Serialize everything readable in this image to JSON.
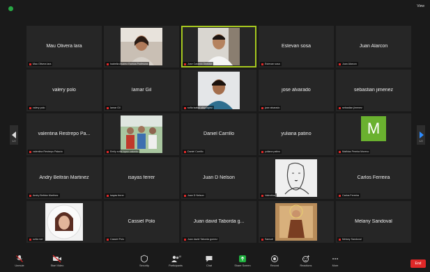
{
  "topbar": {
    "view_label": "View"
  },
  "participants": [
    {
      "name": "Mau Olivera lara",
      "label": "Mau Olivera lara",
      "video": false
    },
    {
      "name": "",
      "label": "Isabella Alvarez Ramos Profesora",
      "video": true,
      "avatar": "woman-portrait"
    },
    {
      "name": "",
      "label": "Jose Caicedo Director",
      "video": true,
      "avatar": "man-portrait",
      "active": true
    },
    {
      "name": "Estevan sosa",
      "label": "Estevan sosa",
      "video": false
    },
    {
      "name": "Juan Alarcon",
      "label": "Juan Alarcon",
      "video": false
    },
    {
      "name": "valery polo",
      "label": "valery polo",
      "video": false
    },
    {
      "name": "Iamar Gil",
      "label": "Iamar Gil",
      "video": false
    },
    {
      "name": "",
      "label": "sofia isabel silva lopez",
      "video": true,
      "avatar": "teen-portrait"
    },
    {
      "name": "jose alvarado",
      "label": "jose alvarado",
      "video": false
    },
    {
      "name": "sebastian jimenez",
      "label": "sebastian jimenez",
      "video": false
    },
    {
      "name": "valentina Restrepo Pa...",
      "label": "valentina Restrepo Palacio",
      "video": false
    },
    {
      "name": "",
      "label": "Emily sofia lopez caicedo",
      "video": true,
      "avatar": "group-photo"
    },
    {
      "name": "Daniel Carrillo",
      "label": "Daniel Carrillo",
      "video": false
    },
    {
      "name": "yuliana patino",
      "label": "yuliana patino",
      "video": false
    },
    {
      "name": "",
      "label": "Mathias Pereira Moreno",
      "video": true,
      "avatar": "letter-m",
      "letter": "M"
    },
    {
      "name": "Andry Beltrán Martinez",
      "label": "Andry Beltrán Martinez",
      "video": false
    },
    {
      "name": "isayas ferrer",
      "label": "isayas ferrer",
      "video": false
    },
    {
      "name": "Juan D Nelson",
      "label": "Juan D Nelson",
      "video": false
    },
    {
      "name": "",
      "label": "Valentina",
      "video": true,
      "avatar": "sketch-portrait"
    },
    {
      "name": "Carlos Ferreira",
      "label": "Carlos Ferreira",
      "video": false
    },
    {
      "name": "",
      "label": "sofia mel",
      "video": true,
      "avatar": "girl-profile"
    },
    {
      "name": "Cassiel Polo",
      "label": "Cassiel Polo",
      "video": false
    },
    {
      "name": "Juan david Taborda g...",
      "label": "Juan david Taborda gomez",
      "video": false
    },
    {
      "name": "",
      "label": "Samuel",
      "video": true,
      "avatar": "saint-figure"
    },
    {
      "name": "Melany Sandoval",
      "label": "Melany Sandoval",
      "video": false
    }
  ],
  "pager": {
    "left": "1/2",
    "right": "1/2"
  },
  "toolbar": {
    "unmute": "Unmute",
    "start_video": "Start Video",
    "security": "Security",
    "participants": "Participants",
    "participants_count": "49",
    "chat": "Chat",
    "share_screen": "Share Screen",
    "record": "Record",
    "reactions": "Reactions",
    "more": "More",
    "end": "End"
  },
  "colors": {
    "accent_green": "#a6c81f",
    "share_green": "#20b03f",
    "end_red": "#e02828",
    "m_avatar": "#6ab12f"
  }
}
